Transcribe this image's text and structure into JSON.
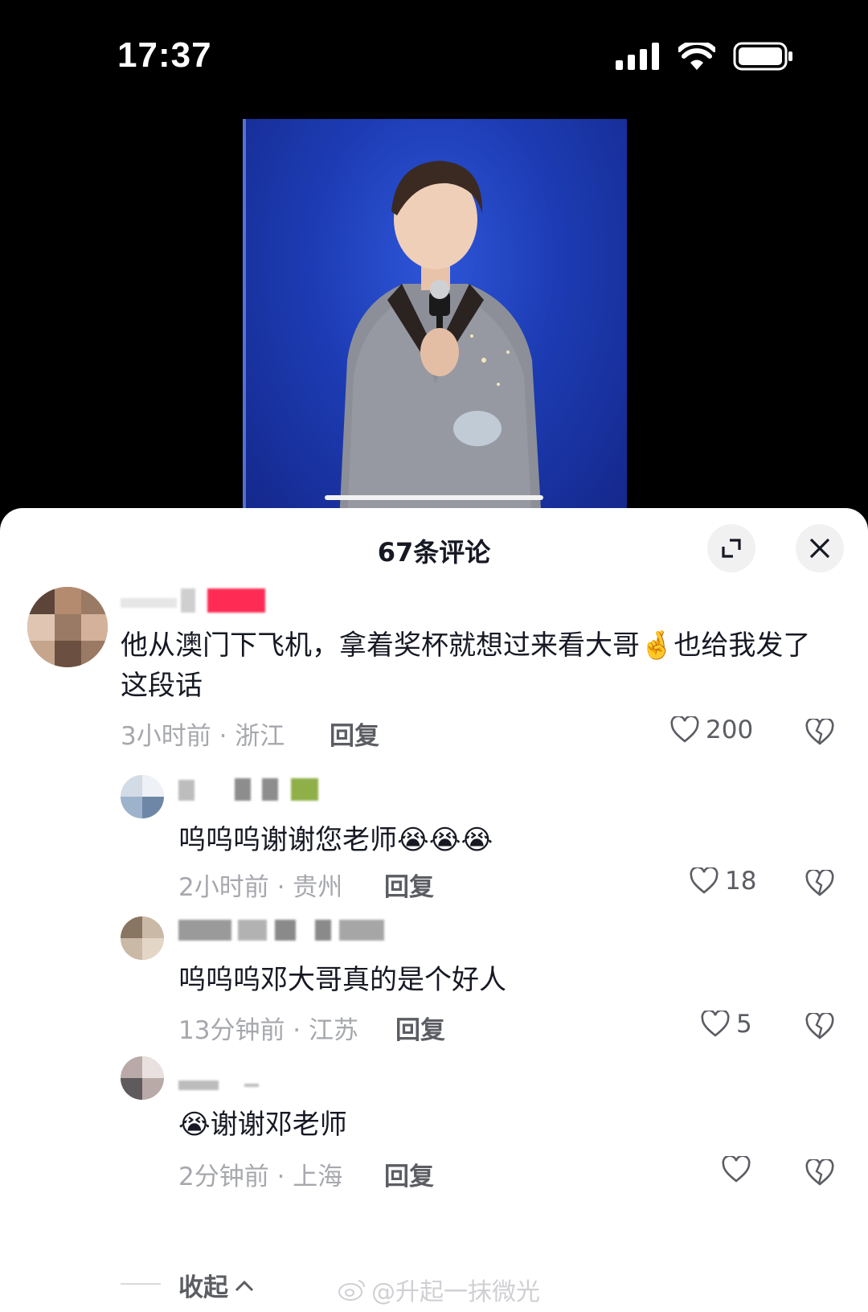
{
  "status_bar": {
    "time": "17:37"
  },
  "sheet": {
    "title": "67条评论"
  },
  "comments": [
    {
      "text": "他从澳门下飞机，拿着奖杯就想过来看大哥🤞也给我发了这段话",
      "time_location": "3小时前 · 浙江",
      "reply_label": "回复",
      "likes": "200"
    },
    {
      "text": "呜呜呜谢谢您老师😭😭😭",
      "time_location": "2小时前 · 贵州",
      "reply_label": "回复",
      "likes": "18"
    },
    {
      "text": "呜呜呜邓大哥真的是个好人",
      "time_location": "13分钟前 · 江苏",
      "reply_label": "回复",
      "likes": "5"
    },
    {
      "text": "😭谢谢邓老师",
      "time_location": "2分钟前 · 上海",
      "reply_label": "回复",
      "likes": ""
    }
  ],
  "collapse_label": "收起",
  "watermark": "@升起一抹微光",
  "colors": {
    "accent_red": "#fe2c55",
    "text_primary": "#161823",
    "text_secondary": "#a6a8ad"
  }
}
